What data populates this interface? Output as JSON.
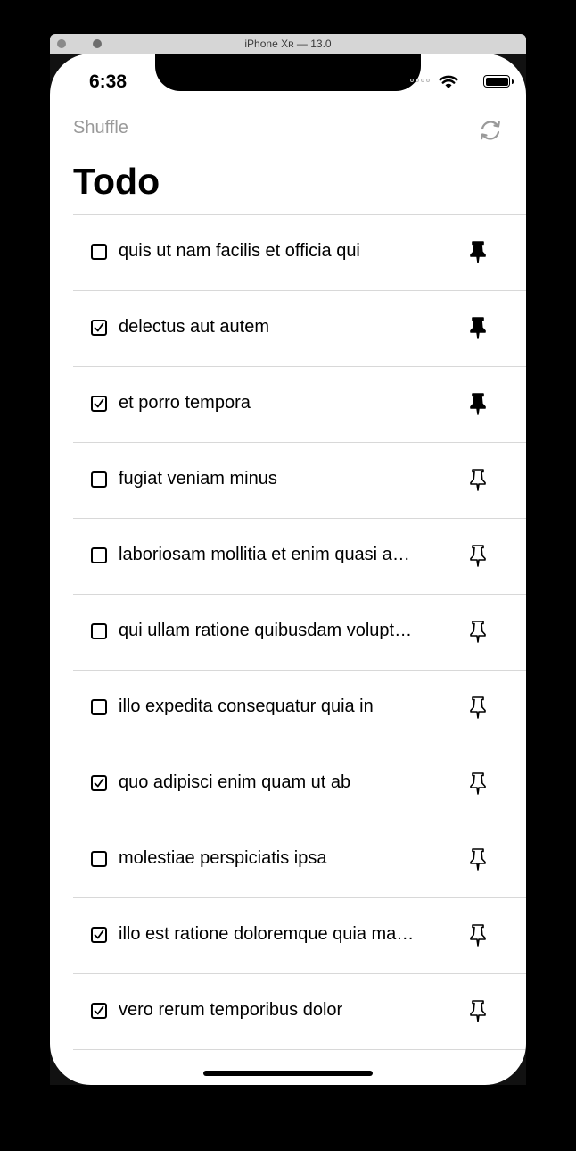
{
  "window": {
    "title": "iPhone Xʀ — 13.0"
  },
  "status_bar": {
    "time": "6:38"
  },
  "nav": {
    "left_button": "Shuffle",
    "right_icon": "refresh-icon",
    "title": "Todo"
  },
  "todos": [
    {
      "text": "quis ut nam facilis et officia qui",
      "checked": false,
      "pinned": true
    },
    {
      "text": "delectus aut autem",
      "checked": true,
      "pinned": true
    },
    {
      "text": "et porro tempora",
      "checked": true,
      "pinned": true
    },
    {
      "text": "fugiat veniam minus",
      "checked": false,
      "pinned": false
    },
    {
      "text": "laboriosam mollitia et enim quasi adi…",
      "checked": false,
      "pinned": false
    },
    {
      "text": "qui ullam ratione quibusdam voluptat…",
      "checked": false,
      "pinned": false
    },
    {
      "text": "illo expedita consequatur quia in",
      "checked": false,
      "pinned": false
    },
    {
      "text": "quo adipisci enim quam ut ab",
      "checked": true,
      "pinned": false
    },
    {
      "text": "molestiae perspiciatis ipsa",
      "checked": false,
      "pinned": false
    },
    {
      "text": "illo est ratione doloremque quia maio…",
      "checked": true,
      "pinned": false
    },
    {
      "text": "vero rerum temporibus dolor",
      "checked": true,
      "pinned": false
    }
  ],
  "colors": {
    "accent_gray": "#9a9a9a",
    "separator": "#d8d8d8",
    "text": "#000000"
  }
}
